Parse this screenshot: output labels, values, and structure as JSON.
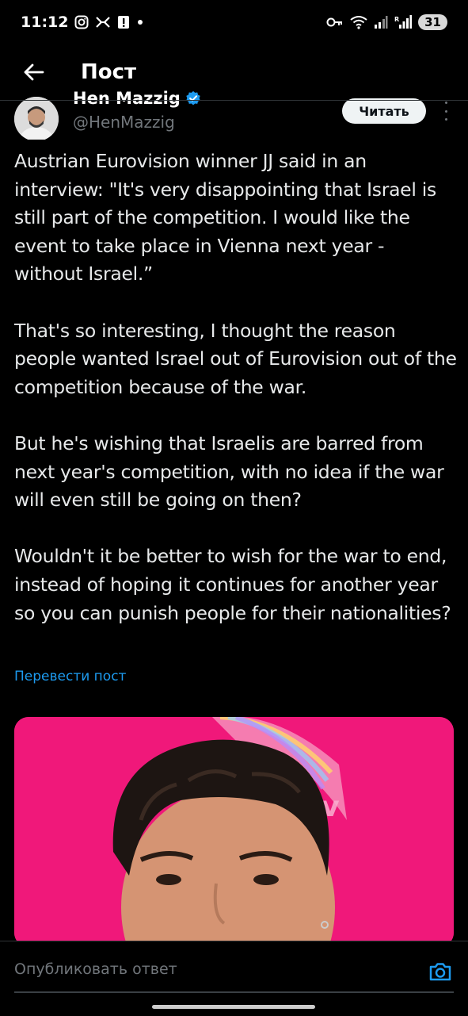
{
  "status_bar": {
    "time": "11:12",
    "battery": "31",
    "left_icons": [
      "instagram-icon",
      "eurovision-icon",
      "alert-icon",
      "dot-icon"
    ],
    "right_icons": [
      "key-icon",
      "wifi-icon",
      "signal-icon",
      "signal-roaming-icon"
    ]
  },
  "header": {
    "title": "Пост"
  },
  "post": {
    "author_name": "Hen Mazzig",
    "author_handle": "@HenMazzig",
    "follow_label": "Читать",
    "paragraphs": [
      "Austrian Eurovision winner JJ said in an interview: \"It's very disappointing that Israel is still part of the competition. I would like the event to take place in Vienna next year - without Israel.”",
      "That's so interesting, I thought the reason people wanted Israel out of Eurovision out of the competition because of the war.",
      "But he's wishing that Israelis are barred from next year's competition, with no idea if the war will even still be going on then?",
      "Wouldn't it be better to wish for the war to end, instead of hoping it continues for another year so you can punish people for their nationalities?"
    ],
    "translate_label": "Перевести пост"
  },
  "reply": {
    "placeholder": "Опубликовать ответ"
  },
  "colors": {
    "accent": "#1d9bf0",
    "background": "#000000",
    "text": "#e7e9ea",
    "secondary_text": "#71767b",
    "media_background": "#f0187a"
  }
}
